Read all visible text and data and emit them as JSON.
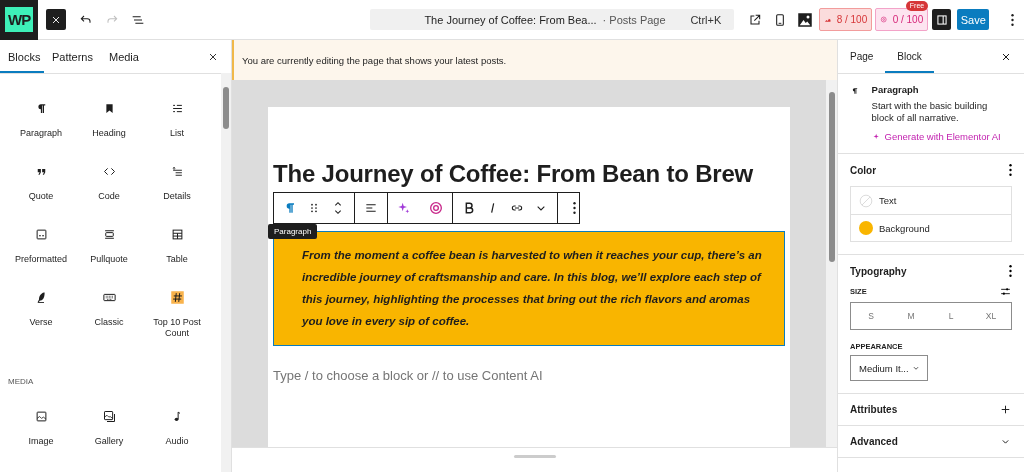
{
  "topbar": {
    "logo": "WP",
    "undo": {
      "disabled": false
    },
    "redo": {
      "disabled": true
    },
    "command": {
      "title": "The Journey of Coffee: From Bea...",
      "suffix": "· Posts Page",
      "shortcut": "Ctrl+K"
    },
    "counters": [
      {
        "text": "8 / 100",
        "kind": "seo"
      },
      {
        "text": "0 / 100",
        "kind": "ai",
        "badge": "Free"
      }
    ],
    "save": "Save"
  },
  "inserter": {
    "tabs": [
      {
        "label": "Blocks",
        "selected": true
      },
      {
        "label": "Patterns",
        "selected": false
      },
      {
        "label": "Media",
        "selected": false
      }
    ],
    "blocks": [
      {
        "label": "Paragraph"
      },
      {
        "label": "Heading"
      },
      {
        "label": "List"
      },
      {
        "label": "Quote"
      },
      {
        "label": "Code"
      },
      {
        "label": "Details"
      },
      {
        "label": "Preformatted"
      },
      {
        "label": "Pullquote"
      },
      {
        "label": "Table"
      },
      {
        "label": "Verse"
      },
      {
        "label": "Classic"
      },
      {
        "label": "Top 10 Post Count"
      }
    ],
    "section": "MEDIA",
    "media_blocks": [
      {
        "label": "Image"
      },
      {
        "label": "Gallery"
      },
      {
        "label": "Audio"
      }
    ]
  },
  "notice": "You are currently editing the page that shows your latest posts.",
  "editor": {
    "title": "The Journey of Coffee: From Bean to Brew",
    "tooltip": "Paragraph",
    "paragraph": "From the moment a coffee bean is harvested to when it reaches your cup, there’s an incredible journey of craftsmanship and care. In this blog, we’ll explore each step of this journey, highlighting the processes that bring out the rich flavors and aromas you love in every sip of coffee.",
    "placeholder": "Type / to choose a block or // to use Content AI"
  },
  "settings": {
    "tabs": [
      {
        "label": "Page",
        "selected": false
      },
      {
        "label": "Block",
        "selected": true
      }
    ],
    "block": {
      "name": "Paragraph",
      "description": "Start with the basic building block of all narrative.",
      "ai_link": "Generate with Elementor AI"
    },
    "color": {
      "title": "Color",
      "items": [
        {
          "label": "Text"
        },
        {
          "label": "Background",
          "color": "#f9b500"
        }
      ]
    },
    "typography": {
      "title": "Typography",
      "size_label": "SIZE",
      "sizes": [
        {
          "label": "S",
          "selected": false
        },
        {
          "label": "M",
          "selected": false
        },
        {
          "label": "L",
          "selected": false
        },
        {
          "label": "XL",
          "selected": false
        }
      ],
      "appearance_label": "APPEARANCE",
      "appearance": "Medium It..."
    },
    "panels": [
      {
        "title": "Attributes",
        "kind": "add"
      },
      {
        "title": "Advanced",
        "kind": "collapse"
      }
    ]
  }
}
